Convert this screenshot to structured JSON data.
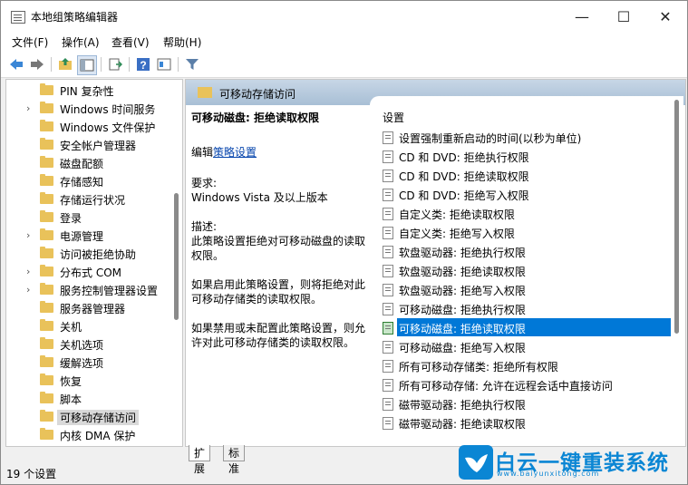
{
  "window": {
    "title": "本地组策略编辑器",
    "minimize": "—",
    "maximize": "☐",
    "close": "✕"
  },
  "menu": [
    "文件(F)",
    "操作(A)",
    "查看(V)",
    "帮助(H)"
  ],
  "tree": {
    "items": [
      {
        "label": "PIN 复杂性",
        "expander": ""
      },
      {
        "label": "Windows 时间服务",
        "expander": "›"
      },
      {
        "label": "Windows 文件保护",
        "expander": ""
      },
      {
        "label": "安全帐户管理器",
        "expander": ""
      },
      {
        "label": "磁盘配额",
        "expander": ""
      },
      {
        "label": "存储感知",
        "expander": ""
      },
      {
        "label": "存储运行状况",
        "expander": ""
      },
      {
        "label": "登录",
        "expander": ""
      },
      {
        "label": "电源管理",
        "expander": "›"
      },
      {
        "label": "访问被拒绝协助",
        "expander": ""
      },
      {
        "label": "分布式 COM",
        "expander": "›"
      },
      {
        "label": "服务控制管理器设置",
        "expander": "›"
      },
      {
        "label": "服务器管理器",
        "expander": ""
      },
      {
        "label": "关机",
        "expander": ""
      },
      {
        "label": "关机选项",
        "expander": ""
      },
      {
        "label": "缓解选项",
        "expander": ""
      },
      {
        "label": "恢复",
        "expander": ""
      },
      {
        "label": "脚本",
        "expander": ""
      },
      {
        "label": "可移动存储访问",
        "expander": "",
        "selected": true
      },
      {
        "label": "内核 DMA 保护",
        "expander": ""
      }
    ]
  },
  "right": {
    "header": "可移动存储访问",
    "desc": {
      "title": "可移动磁盘: 拒绝读取权限",
      "edit_prefix": "编辑",
      "edit_link": "策略设置",
      "req_label": "要求:",
      "req_value": "Windows Vista 及以上版本",
      "desc_label": "描述:",
      "desc_text": "此策略设置拒绝对可移动磁盘的读取权限。",
      "enable_text": "如果启用此策略设置，则将拒绝对此可移动存储类的读取权限。",
      "disable_text": "如果禁用或未配置此策略设置，则允许对此可移动存储类的读取权限。"
    },
    "list_header": "设置",
    "policies": [
      "设置强制重新启动的时间(以秒为单位)",
      "CD 和 DVD: 拒绝执行权限",
      "CD 和 DVD: 拒绝读取权限",
      "CD 和 DVD: 拒绝写入权限",
      "自定义类: 拒绝读取权限",
      "自定义类: 拒绝写入权限",
      "软盘驱动器: 拒绝执行权限",
      "软盘驱动器: 拒绝读取权限",
      "软盘驱动器: 拒绝写入权限",
      "可移动磁盘: 拒绝执行权限",
      "可移动磁盘: 拒绝读取权限",
      "可移动磁盘: 拒绝写入权限",
      "所有可移动存储类: 拒绝所有权限",
      "所有可移动存储: 允许在远程会话中直接访问",
      "磁带驱动器: 拒绝执行权限",
      "磁带驱动器: 拒绝读取权限"
    ],
    "selected_index": 10
  },
  "tabs": [
    "扩展",
    "标准"
  ],
  "status": "19 个设置",
  "brand": {
    "name": "白云一键重装系统",
    "url": "www.baiyunxitong.com"
  }
}
